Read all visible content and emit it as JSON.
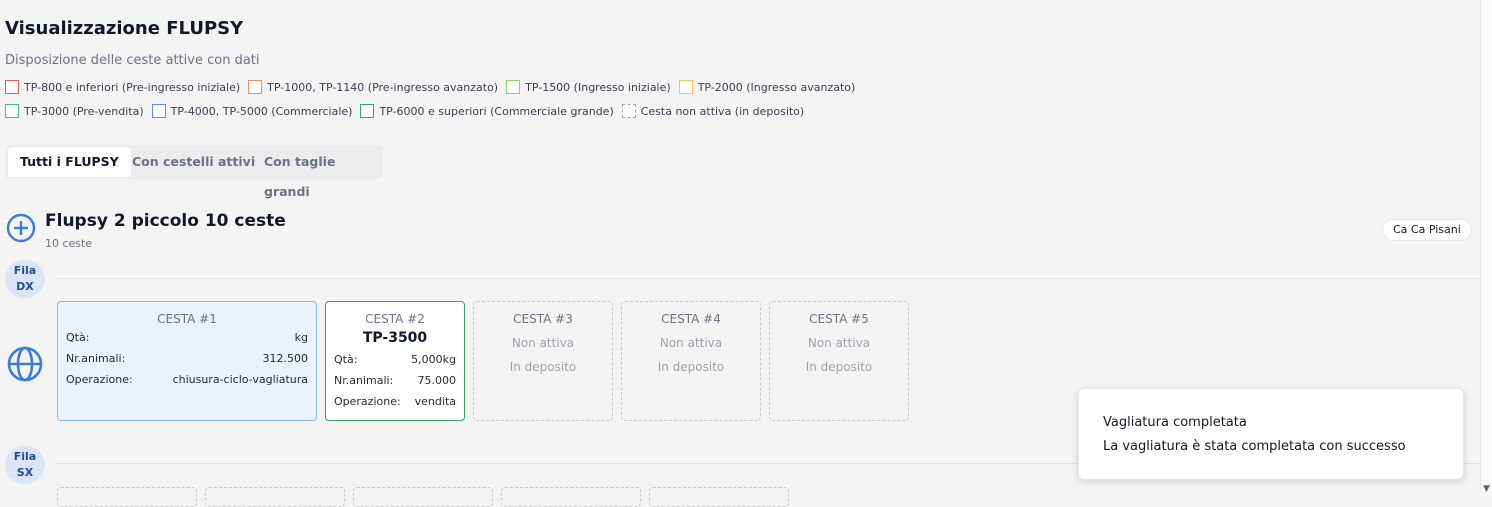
{
  "header": {
    "title": "Visualizzazione FLUPSY",
    "subtitle": "Disposizione delle ceste attive con dati"
  },
  "legend": [
    {
      "label": "TP-800 e inferiori (Pre-ingresso iniziale)",
      "color": "#e05a5a"
    },
    {
      "label": "TP-1000, TP-1140 (Pre-ingresso avanzato)",
      "color": "#e8915a"
    },
    {
      "label": "TP-1500 (Ingresso iniziale)",
      "color": "#8fd06a"
    },
    {
      "label": "TP-2000 (Ingresso avanzato)",
      "color": "#f0c85a"
    },
    {
      "label": "TP-3000 (Pre-vendita)",
      "color": "#3bb8a8"
    },
    {
      "label": "TP-4000, TP-5000 (Commerciale)",
      "color": "#5a8ee0"
    },
    {
      "label": "TP-6000 e superiori (Commerciale grande)",
      "color": "#3aa86a"
    },
    {
      "label": "Cesta non attiva (in deposito)",
      "color": "#9ca3af"
    }
  ],
  "tabs": [
    {
      "label": "Tutti i FLUPSY",
      "active": true
    },
    {
      "label": "Con cestelli attivi",
      "active": false
    },
    {
      "label": "Con taglie grandi",
      "active": false
    }
  ],
  "flupsy": {
    "name": "Flupsy 2 piccolo 10 ceste",
    "count": "10 ceste",
    "location": "Ca Ca Pisani"
  },
  "rows": {
    "dx": {
      "label_line1": "Fila",
      "label_line2": "DX"
    },
    "sx": {
      "label_line1": "Fila",
      "label_line2": "SX"
    }
  },
  "baskets": {
    "b1": {
      "header": "CESTA #1",
      "qty_label": "Qtà:",
      "qty_value": "kg",
      "animals_label": "Nr.animali:",
      "animals_value": "312.500",
      "op_label": "Operazione:",
      "op_value": "chiusura-ciclo-vagliatura"
    },
    "b2": {
      "header": "CESTA #2",
      "size": "TP-3500",
      "qty_label": "Qtà:",
      "qty_value": "5,000kg",
      "animals_label": "Nr.animali:",
      "animals_value": "75.000",
      "op_label": "Operazione:",
      "op_value": "vendita"
    },
    "b3": {
      "header": "CESTA #3",
      "status": "Non attiva",
      "location": "In deposito"
    },
    "b4": {
      "header": "CESTA #4",
      "status": "Non attiva",
      "location": "In deposito"
    },
    "b5": {
      "header": "CESTA #5",
      "status": "Non attiva",
      "location": "In deposito"
    }
  },
  "toast": {
    "title": "Vagliatura completata",
    "description": "La vagliatura è stata completata con successo"
  }
}
